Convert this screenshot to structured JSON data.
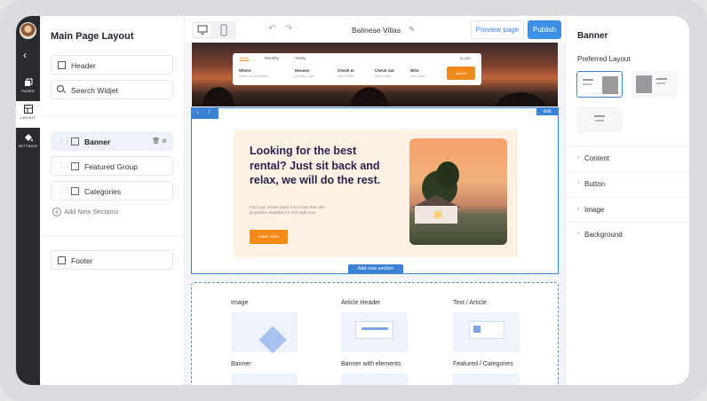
{
  "app": {
    "site_title": "Balinese Villas",
    "preview_label": "Preview page",
    "publish_label": "Publish"
  },
  "rail": {
    "items": [
      {
        "label": "PAGES",
        "icon": "pages-icon"
      },
      {
        "label": "LAYOUT",
        "icon": "layout-icon"
      },
      {
        "label": "SETTINGS",
        "icon": "paint-bucket-icon"
      }
    ]
  },
  "left_panel": {
    "title": "Main Page Layout",
    "header_label": "Header",
    "search_label": "Search Widjet",
    "sections": [
      {
        "label": "Banner",
        "active": true
      },
      {
        "label": "Featured Group",
        "active": false
      },
      {
        "label": "Categories",
        "active": false
      }
    ],
    "add_sections_label": "Add New Sections",
    "footer_label": "Footer"
  },
  "booking": {
    "tabs": [
      "Daily",
      "Monthly",
      "Yearly"
    ],
    "currency": "$ USD",
    "fields": [
      {
        "label": "Where",
        "placeholder": "Search for destination"
      },
      {
        "label": "Houses",
        "placeholder": "Property Type"
      },
      {
        "label": "Check In",
        "placeholder": "Select Date"
      },
      {
        "label": "Check out",
        "placeholder": "Select Date"
      },
      {
        "label": "Who",
        "placeholder": "Add Guest"
      }
    ],
    "button": "Search"
  },
  "banner": {
    "edit_label": "Edit",
    "headline": "Looking for the best rental? Just sit back and relax, we will do the rest.",
    "body": "Find your dream place from more than 30+ properties available for rent right now.",
    "cta": "Learn more",
    "add_new_section": "Add new section"
  },
  "picker": {
    "items": [
      {
        "label": "Image",
        "thumb": "image"
      },
      {
        "label": "Article Header",
        "thumb": "article"
      },
      {
        "label": "Text / Article",
        "thumb": "text"
      },
      {
        "label": "Banner",
        "thumb": "banner"
      },
      {
        "label": "Banner with elements",
        "thumb": "banner-elements"
      },
      {
        "label": "Featured / Categories",
        "thumb": "featured"
      }
    ]
  },
  "right_panel": {
    "title": "Banner",
    "preferred_layout": "Preferred Layout",
    "accordions": [
      "Content",
      "Button",
      "Image",
      "Background"
    ]
  },
  "colors": {
    "accent": "#3b82d6",
    "cta_orange": "#f58a16",
    "rail_dark": "#2b2b2f"
  }
}
